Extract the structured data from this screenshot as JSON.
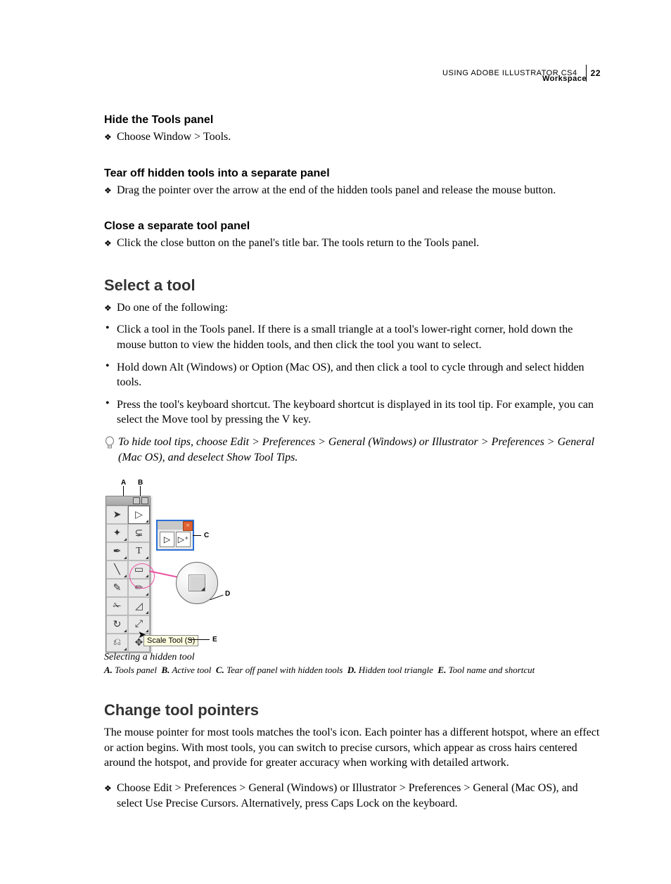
{
  "header": {
    "doc_title": "USING ADOBE ILLUSTRATOR CS4",
    "page_number": "22",
    "section": "Workspace"
  },
  "sections": {
    "hide": {
      "title": "Hide the Tools panel",
      "item": "Choose Window > Tools."
    },
    "tearoff": {
      "title": "Tear off hidden tools into a separate panel",
      "item": "Drag the pointer over the arrow at the end of the hidden tools panel and release the mouse button."
    },
    "close": {
      "title": "Close a separate tool panel",
      "item": "Click the close button on the panel's title bar. The tools return to the Tools panel."
    },
    "select": {
      "title": "Select a tool",
      "intro": "Do one of the following:",
      "bullets": [
        "Click a tool in the Tools panel. If there is a small triangle at a tool's lower-right corner, hold down the mouse button to view the hidden tools, and then click the tool you want to select.",
        "Hold down Alt (Windows) or Option (Mac OS), and then click a tool to cycle through and select hidden tools.",
        "Press the tool's keyboard shortcut. The keyboard shortcut is displayed in its tool tip. For example, you can select the Move tool by pressing the V key."
      ],
      "tip": "To hide tool tips, choose Edit > Preferences > General (Windows) or Illustrator > Preferences > General (Mac OS), and deselect Show Tool Tips."
    },
    "change": {
      "title": "Change tool pointers",
      "para": "The mouse pointer for most tools matches the tool's icon. Each pointer has a different hotspot, where an effect or action begins. With most tools, you can switch to precise cursors, which appear as cross hairs centered around the hotspot, and provide for greater accuracy when working with detailed artwork.",
      "item": "Choose Edit > Preferences > General (Windows) or Illustrator > Preferences > General (Mac OS), and select Use Precise Cursors. Alternatively, press Caps Lock on the keyboard."
    }
  },
  "figure": {
    "labels": {
      "A": "A",
      "B": "B",
      "C": "C",
      "D": "D",
      "E": "E"
    },
    "tooltip": "Scale Tool (S)",
    "caption": "Selecting a hidden tool",
    "legend_parts": {
      "A_lbl": "A.",
      "A_txt": "Tools panel",
      "B_lbl": "B.",
      "B_txt": "Active tool",
      "C_lbl": "C.",
      "C_txt": "Tear off panel with hidden tools",
      "D_lbl": "D.",
      "D_txt": "Hidden tool triangle",
      "E_lbl": "E.",
      "E_txt": "Tool name and shortcut"
    }
  }
}
